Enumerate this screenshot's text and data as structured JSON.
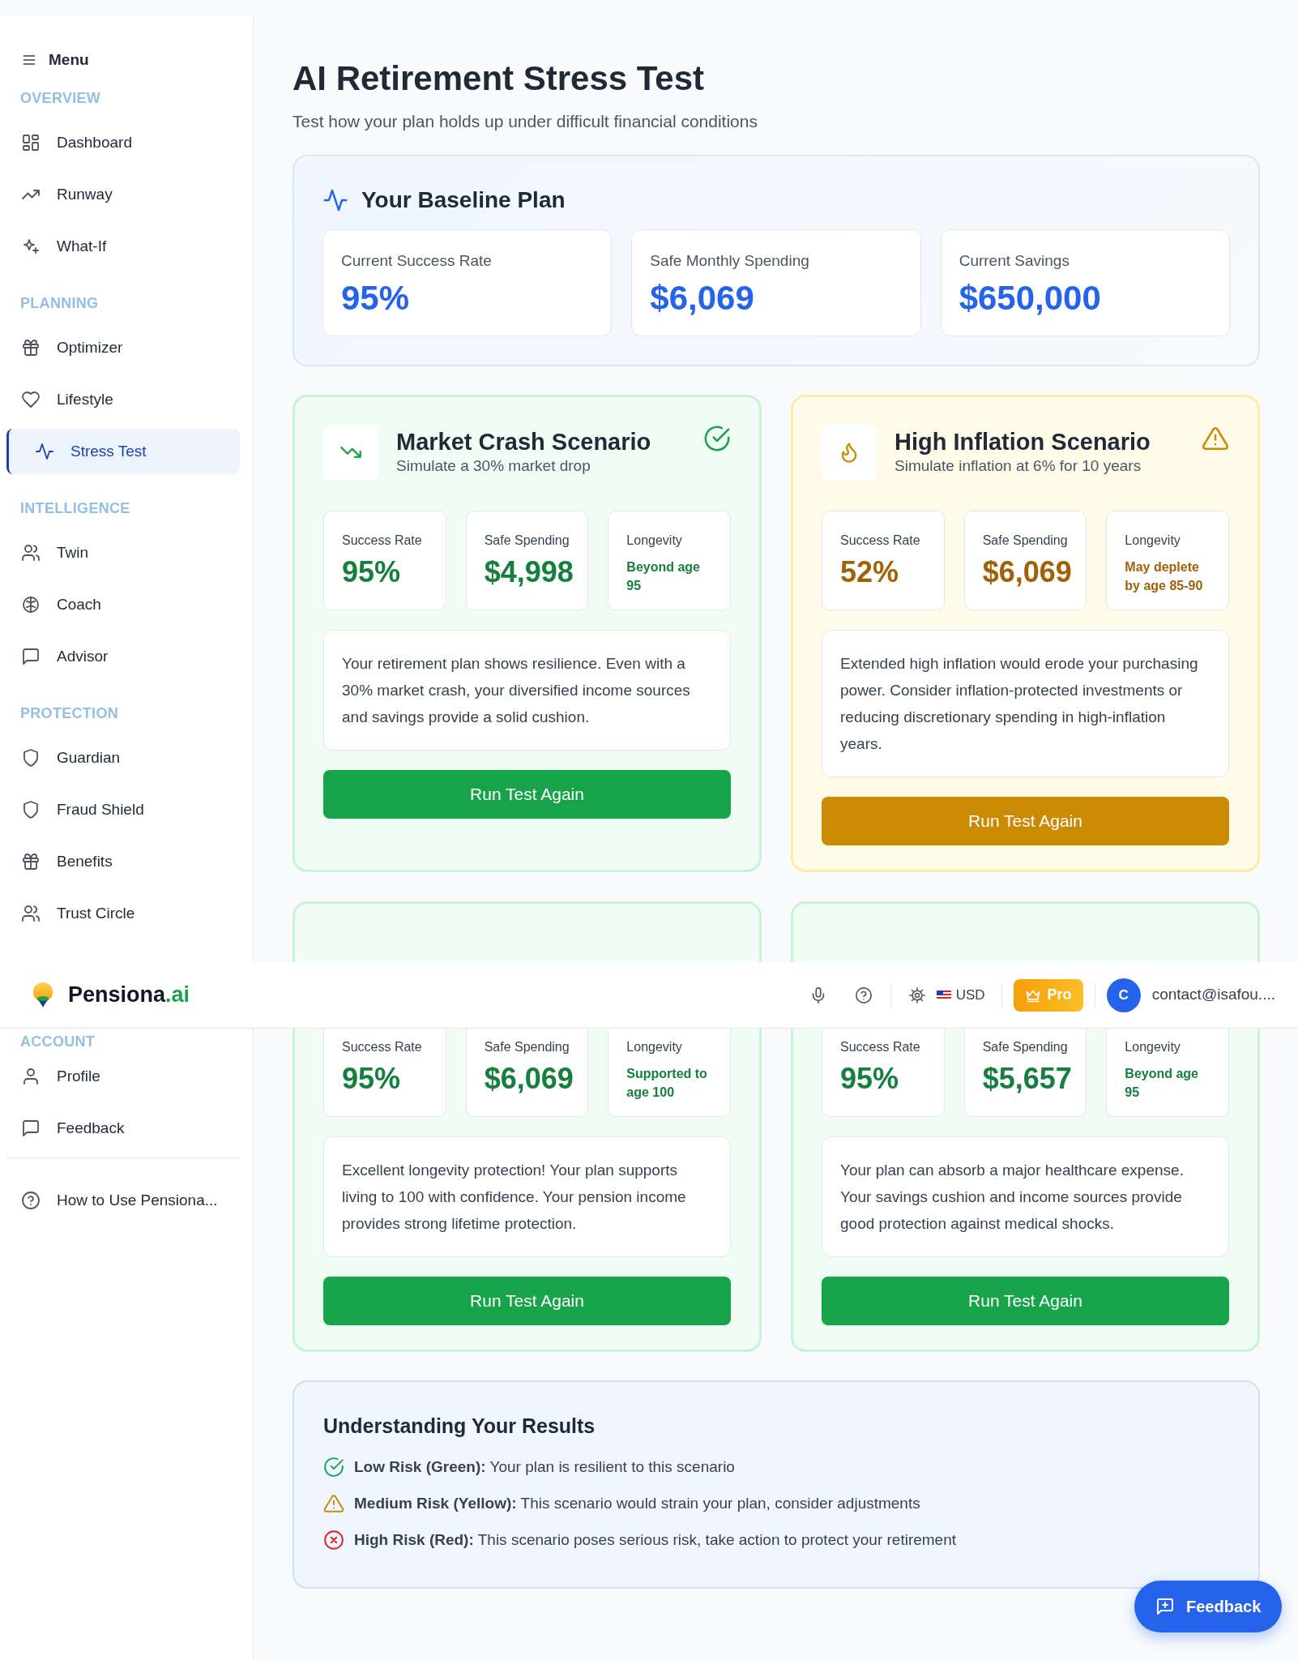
{
  "sidebar": {
    "menu_label": "Menu",
    "sections": [
      {
        "heading": "OVERVIEW",
        "items": [
          {
            "label": "Dashboard",
            "selected": false
          },
          {
            "label": "Runway",
            "selected": false
          },
          {
            "label": "What-If",
            "selected": false
          }
        ]
      },
      {
        "heading": "PLANNING",
        "items": [
          {
            "label": "Optimizer",
            "selected": false
          },
          {
            "label": "Lifestyle",
            "selected": false
          },
          {
            "label": "Stress Test",
            "selected": true
          }
        ]
      },
      {
        "heading": "INTELLIGENCE",
        "items": [
          {
            "label": "Twin",
            "selected": false
          },
          {
            "label": "Coach",
            "selected": false
          },
          {
            "label": "Advisor",
            "selected": false
          }
        ]
      },
      {
        "heading": "PROTECTION",
        "items": [
          {
            "label": "Guardian",
            "selected": false
          },
          {
            "label": "Fraud Shield",
            "selected": false
          },
          {
            "label": "Benefits",
            "selected": false
          },
          {
            "label": "Trust Circle",
            "selected": false
          }
        ]
      },
      {
        "heading": "ACCOUNT",
        "items": [
          {
            "label": "Profile",
            "selected": false
          },
          {
            "label": "Feedback",
            "selected": false
          }
        ]
      }
    ],
    "footer_item": "How to Use Pensiona..."
  },
  "header": {
    "brand": "Pensiona",
    "brand_suffix": ".ai",
    "currency": "USD",
    "plan_button": "Pro",
    "avatar_initial": "C",
    "email": "contact@isafou...."
  },
  "page": {
    "title": "AI Retirement Stress Test",
    "subtitle": "Test how your plan holds up under difficult financial conditions"
  },
  "baseline": {
    "title": "Your Baseline Plan",
    "metrics": [
      {
        "label": "Current Success Rate",
        "value": "95%"
      },
      {
        "label": "Safe Monthly Spending",
        "value": "$6,069"
      },
      {
        "label": "Current Savings",
        "value": "$650,000"
      }
    ]
  },
  "scenarios": [
    {
      "kind": "low",
      "title": "Market Crash Scenario",
      "subtitle": "Simulate a 30% market drop",
      "stats": [
        {
          "kind": "metric",
          "label": "Success Rate",
          "value": "95%"
        },
        {
          "kind": "metric",
          "label": "Safe Spending",
          "value": "$4,998"
        },
        {
          "kind": "note",
          "label": "Longevity",
          "value": "Beyond age 95"
        }
      ],
      "description": "Your retirement plan shows resilience. Even with a 30% market crash, your diversified income sources and savings provide a solid cushion.",
      "button": "Run Test Again"
    },
    {
      "kind": "medium",
      "title": "High Inflation Scenario",
      "subtitle": "Simulate inflation at 6% for 10 years",
      "stats": [
        {
          "kind": "metric",
          "label": "Success Rate",
          "value": "52%"
        },
        {
          "kind": "metric",
          "label": "Safe Spending",
          "value": "$6,069"
        },
        {
          "kind": "note",
          "label": "Longevity",
          "value": "May deplete by age 85-90"
        }
      ],
      "description": "Extended high inflation would erode your purchasing power. Consider inflation-protected investments or reducing discretionary spending in high-inflation years.",
      "button": "Run Test Again"
    },
    {
      "kind": "low",
      "stats": [
        {
          "kind": "metric",
          "label": "Success Rate",
          "value": "95%"
        },
        {
          "kind": "metric",
          "label": "Safe Spending",
          "value": "$6,069"
        },
        {
          "kind": "note",
          "label": "Longevity",
          "value": "Supported to age 100"
        }
      ],
      "description": "Excellent longevity protection! Your plan supports living to 100 with confidence. Your pension income provides strong lifetime protection.",
      "button": "Run Test Again"
    },
    {
      "kind": "low",
      "stats": [
        {
          "kind": "metric",
          "label": "Success Rate",
          "value": "95%"
        },
        {
          "kind": "metric",
          "label": "Safe Spending",
          "value": "$5,657"
        },
        {
          "kind": "note",
          "label": "Longevity",
          "value": "Beyond age 95"
        }
      ],
      "description": "Your plan can absorb a major healthcare expense. Your savings cushion and income sources provide good protection against medical shocks.",
      "button": "Run Test Again"
    }
  ],
  "legend": {
    "title": "Understanding Your Results",
    "items": [
      {
        "kind": "low",
        "text": "**Low Risk (Green):** Your plan is resilient to this scenario"
      },
      {
        "kind": "medium",
        "text": "**Medium Risk (Yellow):** This scenario would strain your plan, consider adjustments"
      },
      {
        "kind": "high",
        "text": "**High Risk (Red):** This scenario poses serious risk, take action to protect your retirement"
      }
    ]
  },
  "feedback_button": "Feedback"
}
